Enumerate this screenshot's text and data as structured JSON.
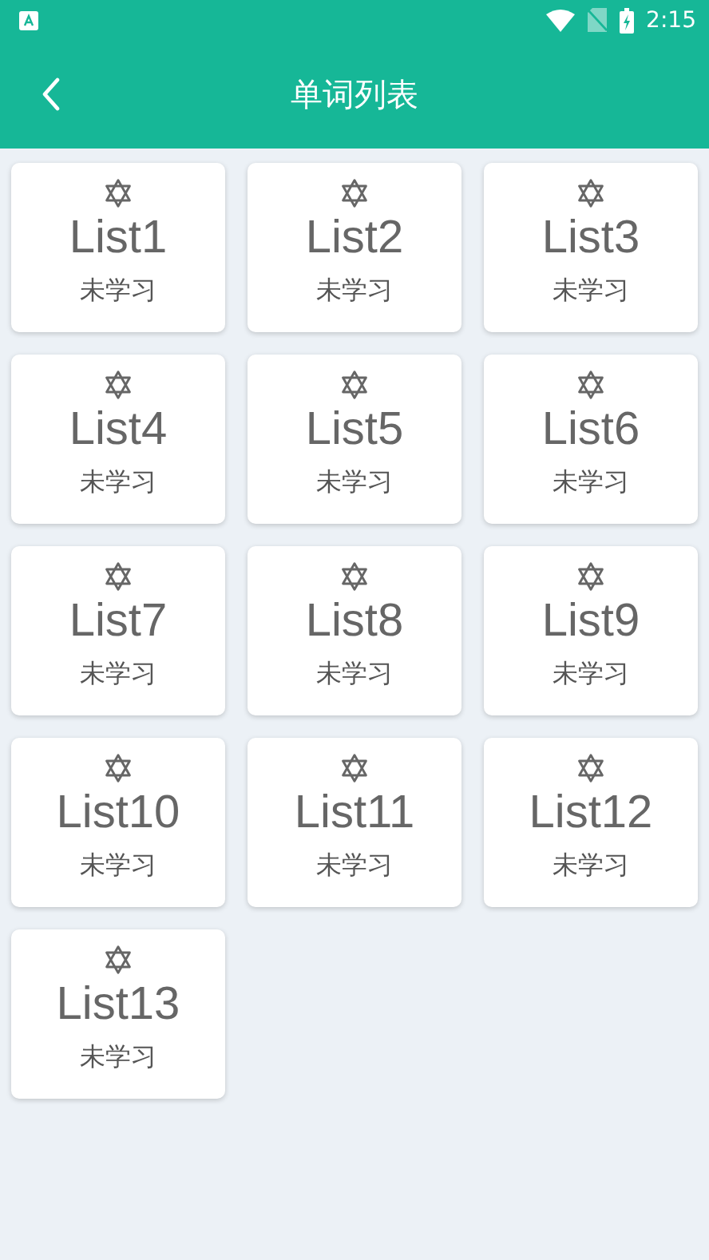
{
  "status_bar": {
    "time": "2:15"
  },
  "app_bar": {
    "title": "单词列表"
  },
  "lists": [
    {
      "name": "List1",
      "status": "未学习"
    },
    {
      "name": "List2",
      "status": "未学习"
    },
    {
      "name": "List3",
      "status": "未学习"
    },
    {
      "name": "List4",
      "status": "未学习"
    },
    {
      "name": "List5",
      "status": "未学习"
    },
    {
      "name": "List6",
      "status": "未学习"
    },
    {
      "name": "List7",
      "status": "未学习"
    },
    {
      "name": "List8",
      "status": "未学习"
    },
    {
      "name": "List9",
      "status": "未学习"
    },
    {
      "name": "List10",
      "status": "未学习"
    },
    {
      "name": "List11",
      "status": "未学习"
    },
    {
      "name": "List12",
      "status": "未学习"
    },
    {
      "name": "List13",
      "status": "未学习"
    }
  ]
}
